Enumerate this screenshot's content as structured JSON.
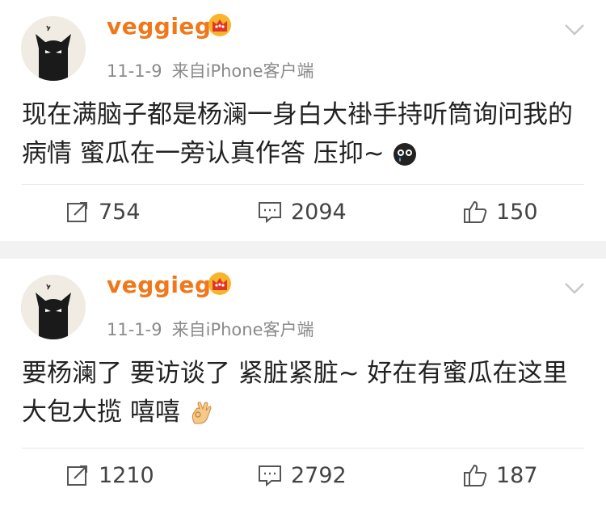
{
  "posts": [
    {
      "username": "veggieg",
      "date": "11-1-9",
      "source": "来自iPhone客户端",
      "text": "现在满脑子都是杨澜一身白大褂手持听筒询问我的病情 蜜瓜在一旁认真作答 压抑~",
      "emoji": "crying-face-emoji",
      "reposts": "754",
      "comments": "2094",
      "likes": "150"
    },
    {
      "username": "veggieg",
      "date": "11-1-9",
      "source": "来自iPhone客户端",
      "text": "要杨澜了 要访谈了 紧脏紧脏~ 好在有蜜瓜在这里大包大揽 嘻嘻",
      "emoji": "ok-hand-emoji",
      "reposts": "1210",
      "comments": "2792",
      "likes": "187"
    }
  ],
  "colors": {
    "username": "#f0771a",
    "meta": "#8a8a8a",
    "background": "#f2f2f2",
    "card": "#ffffff"
  },
  "icons": [
    "cat-avatar",
    "crown-badge-icon",
    "chevron-down-icon",
    "repost-icon",
    "comment-icon",
    "like-icon"
  ]
}
